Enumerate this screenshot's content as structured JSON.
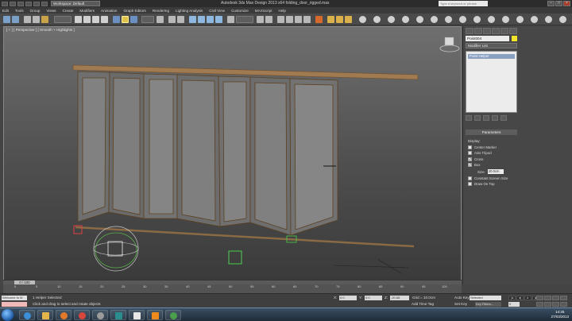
{
  "window": {
    "title": "Autodesk 3ds Max Design 2013 x64   folding_door_rigged.max",
    "workspace": "Workspace: Default",
    "search_placeholder": "Type a keyword or phrase"
  },
  "menu": [
    "Edit",
    "Tools",
    "Group",
    "Views",
    "Create",
    "Modifiers",
    "Animation",
    "Graph Editors",
    "Rendering",
    "Lighting Analysis",
    "Civil View",
    "Customize",
    "MAXScript",
    "Help"
  ],
  "viewport": {
    "label": "[ + ] [ Perspective ] [ Smooth + Highlights ]"
  },
  "command_panel": {
    "object_name": "Point004",
    "modifier_list": "Modifier List",
    "stack_item": "Point Helper",
    "rollout_title": "Parameters",
    "display_label": "Display:",
    "options": [
      {
        "label": "Center Marker",
        "checked": false
      },
      {
        "label": "Axis Tripod",
        "checked": false
      },
      {
        "label": "Cross",
        "checked": true
      },
      {
        "label": "Box",
        "checked": true
      }
    ],
    "size_label": "Size:",
    "size_value": "20.0cm",
    "options2": [
      {
        "label": "Constant Screen Size",
        "checked": false
      },
      {
        "label": "Draw On Top",
        "checked": false
      }
    ]
  },
  "timeline": {
    "slider": "0 / 100",
    "ticks": [
      "0",
      "5",
      "10",
      "15",
      "20",
      "25",
      "30",
      "35",
      "40",
      "45",
      "50",
      "55",
      "60",
      "65",
      "70",
      "75",
      "80",
      "85",
      "90",
      "95",
      "100"
    ]
  },
  "status": {
    "maxscript": "Welcome to M",
    "selection": "1 Helper Selected",
    "prompt": "Click and drag to select and rotate objects",
    "x_label": "X:",
    "x_value": "0.0",
    "y_label": "Y:",
    "y_value": "0.0",
    "z_label": "Z:",
    "z_value": "-20.66",
    "grid": "Grid = 10.0cm",
    "add_time_tag": "Add Time Tag",
    "auto_key": "Auto Key",
    "set_key": "Set Key",
    "selected": "Selected",
    "key_filters": "Key Filters...",
    "frame": "0"
  },
  "taskbar": {
    "time": "14:25",
    "date": "27/03/2013"
  },
  "colors": {
    "object_color": "#f1e42a",
    "wood": "#8a6a45"
  }
}
